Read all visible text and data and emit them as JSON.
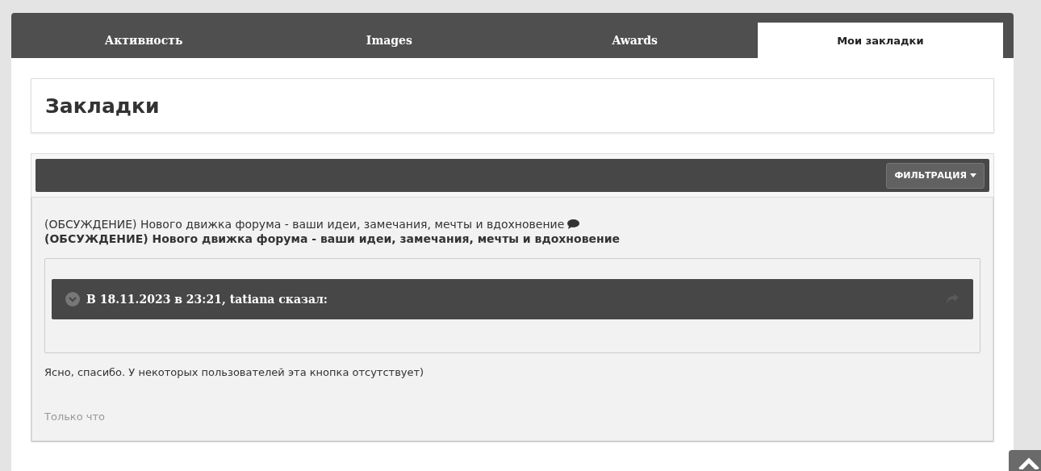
{
  "tabs": [
    {
      "label": "Активность",
      "selected": false
    },
    {
      "label": "Images",
      "selected": false
    },
    {
      "label": "Awards",
      "selected": false
    },
    {
      "label": "Мои закладки",
      "selected": true
    }
  ],
  "page_title": "Закладки",
  "filter_button": {
    "label": "ФИЛЬТРАЦИЯ"
  },
  "bookmark": {
    "topic_link": "(ОБСУЖДЕНИЕ) Нового движка форума - ваши идеи, замечания, мечты и вдохновение",
    "topic_title": "(ОБСУЖДЕНИЕ) Нового движка форума - ваши идеи, замечания, мечты и вдохновение",
    "quote_header": "В 18.11.2023 в 23:21, tatiana сказал:",
    "text": "Ясно, спасибо. У некоторых пользователей эта кнопка отсутствует)",
    "time": "Только что"
  }
}
